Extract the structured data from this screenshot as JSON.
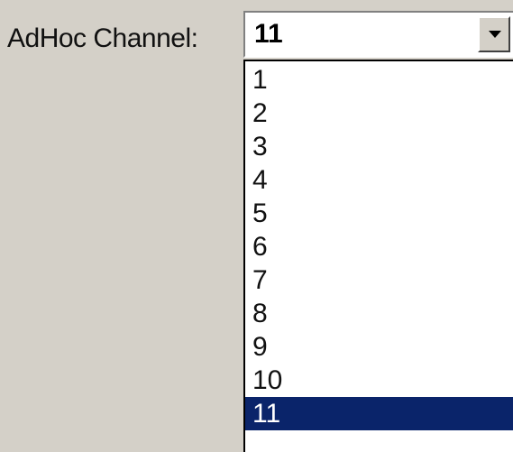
{
  "field": {
    "label": "AdHoc Channel:",
    "selected_value": "11"
  },
  "dropdown": {
    "options": [
      "1",
      "2",
      "3",
      "4",
      "5",
      "6",
      "7",
      "8",
      "9",
      "10",
      "11"
    ],
    "selected_index": 10
  },
  "icons": {
    "combo_button": "chevron-down-icon"
  },
  "colors": {
    "window_background": "#d4d0c8",
    "list_background": "#ffffff",
    "selection_background": "#0a246a",
    "selection_text": "#ffffff"
  }
}
